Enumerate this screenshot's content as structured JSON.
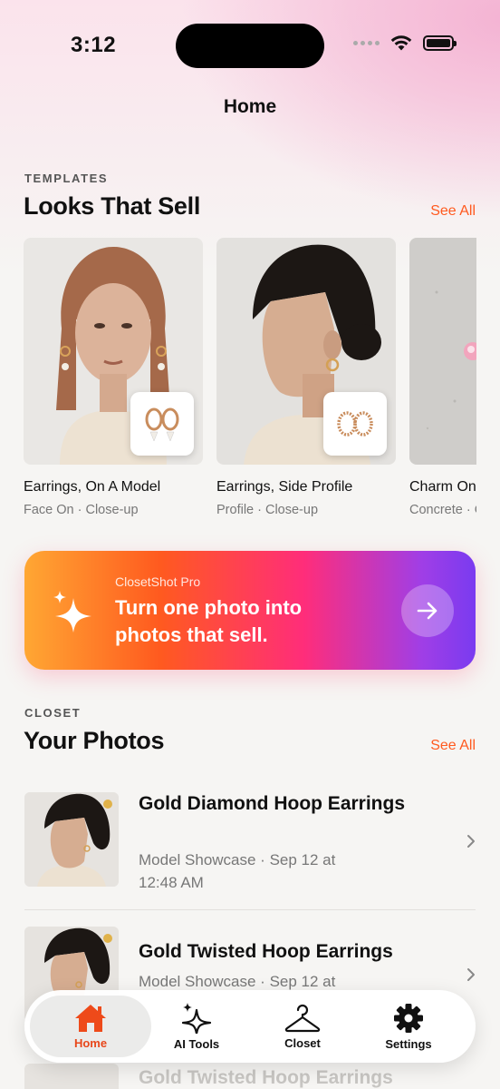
{
  "status_bar": {
    "time": "3:12"
  },
  "nav": {
    "title": "Home"
  },
  "templates": {
    "label": "TEMPLATES",
    "title": "Looks That Sell",
    "see_all": "See All",
    "cards": [
      {
        "title": "Earrings, On A Model",
        "subtitle": "Face On · Close-up"
      },
      {
        "title": "Earrings, Side Profile",
        "subtitle": "Profile · Close-up"
      },
      {
        "title": "Charm On Concrete",
        "subtitle": "Concrete · Close-up"
      }
    ]
  },
  "promo": {
    "eyebrow": "ClosetShot Pro",
    "headline": "Turn one photo into photos that sell.",
    "icon": "sparkles-icon"
  },
  "closet": {
    "label": "CLOSET",
    "title": "Your Photos",
    "see_all": "See All",
    "items": [
      {
        "title": "Gold Diamond Hoop Earrings",
        "meta": "Model Showcase · Sep 12 at 12:48 AM"
      },
      {
        "title": "Gold Twisted Hoop Earrings",
        "meta": "Model Showcase · Sep 12 at"
      },
      {
        "title": "Gold Twisted Hoop Earrings",
        "meta": ""
      }
    ]
  },
  "tabbar": {
    "tabs": [
      {
        "label": "Home",
        "icon": "home-icon",
        "active": true
      },
      {
        "label": "AI Tools",
        "icon": "sparkles-icon",
        "active": false
      },
      {
        "label": "Closet",
        "icon": "hanger-icon",
        "active": false
      },
      {
        "label": "Settings",
        "icon": "gear-icon",
        "active": false
      }
    ]
  },
  "colors": {
    "accent": "#ff5a1f",
    "background": "#f6f5f3",
    "promo_gradient": [
      "#ffa733",
      "#ff5a1f",
      "#ff2d7a",
      "#7a3bf0"
    ]
  }
}
